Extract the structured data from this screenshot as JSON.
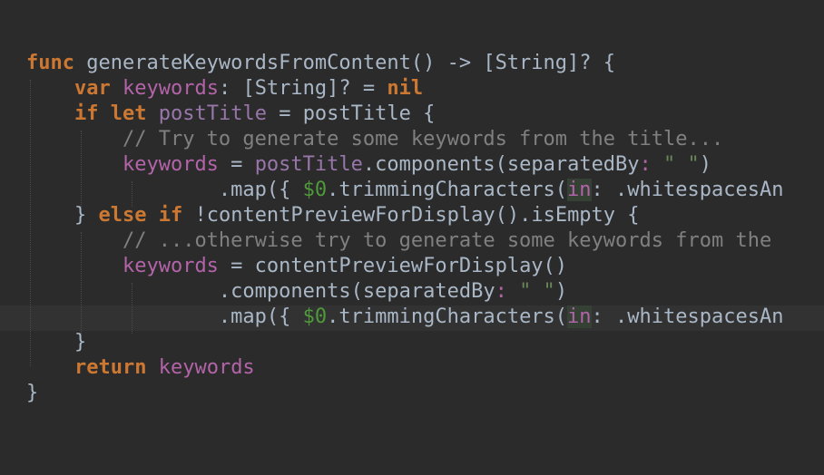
{
  "editor": {
    "language": "Swift",
    "theme_colors": {
      "background": "#2b2b2b",
      "keyword": "#cc7832",
      "variable": "#b364a8",
      "string": "#6a8759",
      "comment": "#808080",
      "default": "#a9b7c6"
    },
    "lines": [
      {
        "tokens": [
          "func",
          " generateKeywordsFromContent() -> [String]? {"
        ]
      },
      {
        "tokens": [
          "var",
          " ",
          "keywords",
          ": [String]? = ",
          "nil"
        ]
      },
      {
        "tokens": [
          "if",
          " ",
          "let",
          " ",
          "postTitle",
          " = postTitle {"
        ]
      },
      {
        "tokens": [
          "// Try to generate some keywords from the title..."
        ]
      },
      {
        "tokens": [
          "keywords",
          " = ",
          "postTitle",
          ".components(separatedBy",
          ": ",
          "\" \"",
          ")"
        ]
      },
      {
        "tokens": [
          ".map({ ",
          "$0",
          ".trimmingCharacters(",
          "in",
          ": .whitespacesAn"
        ]
      },
      {
        "tokens": [
          "} ",
          "else",
          " ",
          "if",
          " !contentPreviewForDisplay().isEmpty {"
        ]
      },
      {
        "tokens": [
          "// ...otherwise try to generate some keywords from the "
        ]
      },
      {
        "tokens": [
          "keywords",
          " = contentPreviewForDisplay()"
        ]
      },
      {
        "tokens": [
          ".components(separatedBy",
          ": ",
          "\" \"",
          ")"
        ]
      },
      {
        "tokens": [
          ".map({ ",
          "$0",
          ".trimmingCharacters(",
          "in",
          ": .whitespacesAn"
        ]
      },
      {
        "tokens": [
          "}"
        ]
      },
      {
        "tokens": [
          "return",
          " ",
          "keywords"
        ]
      },
      {
        "tokens": [
          "}"
        ]
      }
    ]
  }
}
